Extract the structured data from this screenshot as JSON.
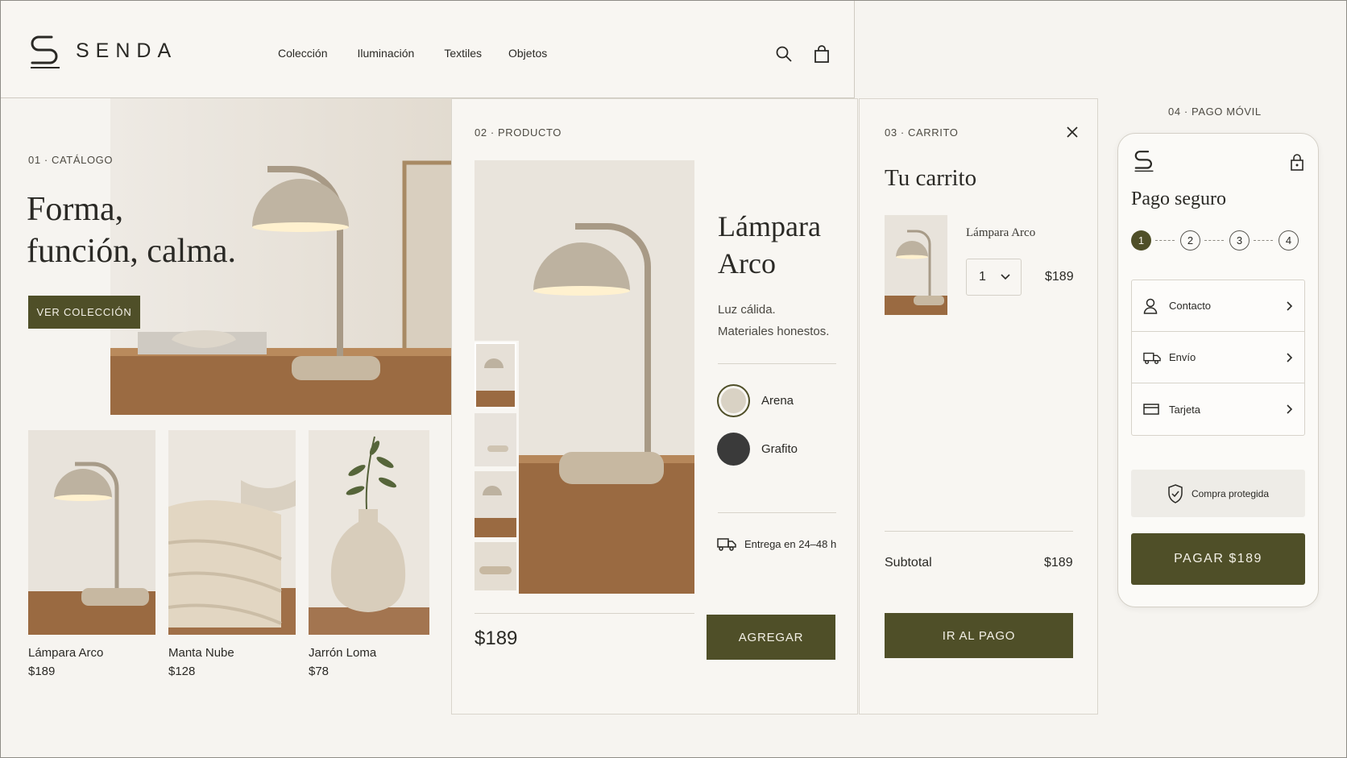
{
  "brand": {
    "name": "SENDA"
  },
  "nav": {
    "items": [
      {
        "label": "Colección"
      },
      {
        "label": "Iluminación"
      },
      {
        "label": "Textiles"
      },
      {
        "label": "Objetos"
      }
    ]
  },
  "catalog": {
    "section_label": "01 · CATÁLOGO",
    "headline_line1": "Forma,",
    "headline_line2": "función, calma.",
    "cta": "VER COLECCIÓN",
    "products": [
      {
        "name": "Lámpara Arco",
        "price": "$189"
      },
      {
        "name": "Manta Nube",
        "price": "$128"
      },
      {
        "name": "Jarrón Loma",
        "price": "$78"
      }
    ]
  },
  "product": {
    "section_label": "02 · PRODUCTO",
    "title_line1": "Lámpara",
    "title_line2": "Arco",
    "desc_line1": "Luz cálida.",
    "desc_line2": "Materiales honestos.",
    "colors": [
      {
        "name": "Arena",
        "hex": "#d9d2c4",
        "selected": true
      },
      {
        "name": "Grafito",
        "hex": "#3a3a3a",
        "selected": false
      }
    ],
    "delivery": "Entrega en 24–48 h",
    "price": "$189",
    "add_button": "AGREGAR"
  },
  "cart": {
    "section_label": "03 · CARRITO",
    "title": "Tu carrito",
    "item_name": "Lámpara Arco",
    "quantity": "1",
    "item_price": "$189",
    "subtotal_label": "Subtotal",
    "subtotal_value": "$189",
    "checkout_button": "IR AL PAGO"
  },
  "mobile": {
    "section_label": "04 · PAGO MÓVIL",
    "title": "Pago seguro",
    "steps": [
      "1",
      "2",
      "3",
      "4"
    ],
    "current_step": 1,
    "rows": [
      {
        "label": "Contacto",
        "icon": "user-icon"
      },
      {
        "label": "Envío",
        "icon": "truck-icon"
      },
      {
        "label": "Tarjeta",
        "icon": "card-icon"
      }
    ],
    "protected": "Compra protegida",
    "pay_button": "PAGAR $189"
  },
  "colors": {
    "olive": "#4f4f28",
    "background": "#f6f4f0"
  }
}
